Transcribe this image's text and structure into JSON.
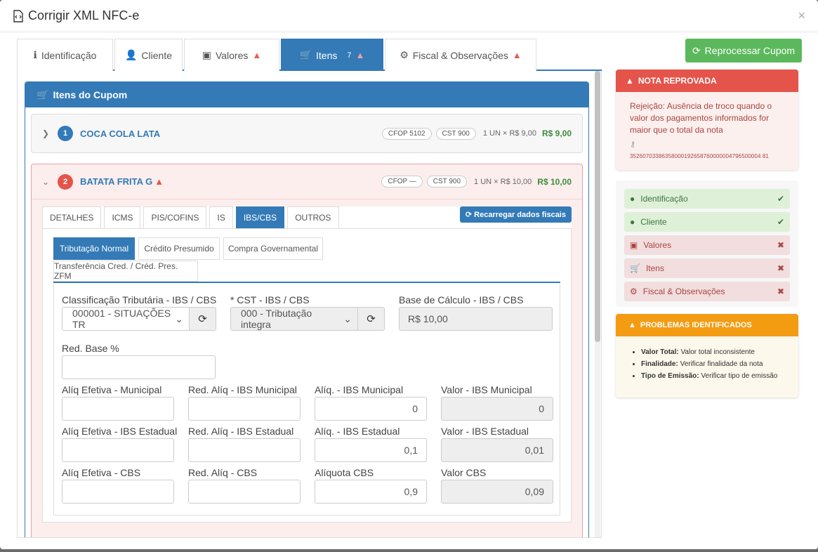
{
  "window": {
    "title": "Corrigir XML NFC-e",
    "close": "×"
  },
  "tabs": [
    {
      "label": "Identificação",
      "icon": "info-icon"
    },
    {
      "label": "Cliente",
      "icon": "user-icon"
    },
    {
      "label": "Valores",
      "icon": "money-icon"
    },
    {
      "label": "Itens",
      "badge": "7",
      "icon": "cart-icon"
    },
    {
      "label": "Fiscal & Observações",
      "icon": "cogs-icon"
    }
  ],
  "panel": {
    "title": "Itens do Cupom"
  },
  "items": [
    {
      "num": "1",
      "name": "COCA COLA LATA",
      "cfop": "CFOP 5102",
      "cst": "CST 900",
      "qty": "1 UN × R$ 9,00",
      "total": "R$ 9,00"
    },
    {
      "num": "2",
      "name": "BATATA FRITA G",
      "cfop": "CFOP —",
      "cst": "CST 900",
      "qty": "1 UN × R$ 10,00",
      "total": "R$ 10,00"
    }
  ],
  "subtabs": [
    "DETALHES",
    "ICMS",
    "PIS/COFINS",
    "IS",
    "IBS/CBS",
    "OUTROS"
  ],
  "reload_button": "Recarregar dados fiscais",
  "tributacao_tabs": [
    "Tributação Normal",
    "Crédito Presumido",
    "Compra Governamental",
    "Transferência Cred. / Créd. Pres. ZFM"
  ],
  "fields": {
    "class_trib": {
      "label": "Classificação Tributária - IBS / CBS",
      "value": "000001 - SITUAÇÕES TR"
    },
    "cst": {
      "label": "* CST - IBS / CBS",
      "value": "000 - Tributação integra"
    },
    "base": {
      "label": "Base de Cálculo - IBS / CBS",
      "value": "R$ 10,00"
    },
    "red_base": {
      "label": "Red. Base %",
      "value": ""
    },
    "rows": [
      {
        "a": "Alíq Efetiva - Municipal",
        "b": "Red. Alíq - IBS Municipal",
        "c": "Alíq. - IBS Municipal",
        "c_val": "0",
        "d": "Valor - IBS Municipal",
        "d_val": "0"
      },
      {
        "a": "Alíq Efetiva - IBS Estadual",
        "b": "Red. Alíq - IBS Estadual",
        "c": "Alíq. - IBS Estadual",
        "c_val": "0,1",
        "d": "Valor - IBS Estadual",
        "d_val": "0,01"
      },
      {
        "a": "Alíq Efetiva - CBS",
        "b": "Red. Alíq - CBS",
        "c": "Alíquota CBS",
        "c_val": "0,9",
        "d": "Valor CBS",
        "d_val": "0,09"
      }
    ]
  },
  "reprocess_button": "Reprocessar Cupom",
  "rejection": {
    "title": "NOTA REPROVADA",
    "message": "Rejeição: Ausência de troco quando o valor dos pagamentos informados for maior que o total da nota",
    "chave": "35260703386358000192658760000004796500004 81"
  },
  "status": [
    {
      "label": "Identificação",
      "ok": true,
      "icon": "info-icon"
    },
    {
      "label": "Cliente",
      "ok": true,
      "icon": "user-icon"
    },
    {
      "label": "Valores",
      "ok": false,
      "icon": "money-icon"
    },
    {
      "label": "Itens",
      "ok": false,
      "icon": "cart-icon"
    },
    {
      "label": "Fiscal & Observações",
      "ok": false,
      "icon": "cogs-icon"
    }
  ],
  "problems": {
    "title": "PROBLEMAS IDENTIFICADOS",
    "list": [
      {
        "key": "Valor Total:",
        "text": "Valor total inconsistente"
      },
      {
        "key": "Finalidade:",
        "text": "Verificar finalidade da nota"
      },
      {
        "key": "Tipo de Emissão:",
        "text": "Verificar tipo de emissão"
      }
    ]
  },
  "colors": {
    "primary": "#337ab7",
    "success": "#5cb85c",
    "danger": "#e5544b",
    "warning": "#f39c12"
  }
}
